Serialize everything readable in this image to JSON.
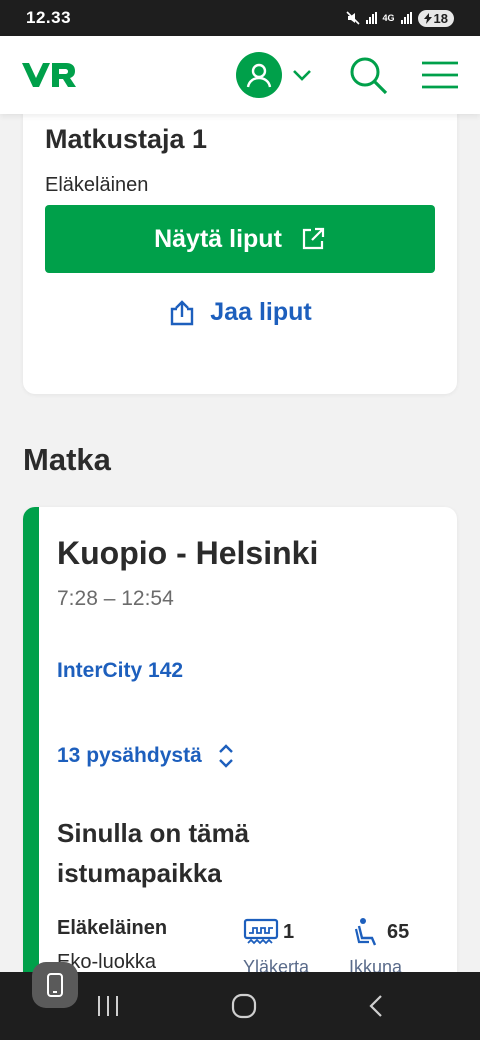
{
  "status_bar": {
    "time": "12.33",
    "network": "4G",
    "battery": "18"
  },
  "header": {
    "logo_text": "VR",
    "brand_color": "#00a04a",
    "icons": [
      "user-icon",
      "chevron-down-icon",
      "search-icon",
      "menu-icon"
    ]
  },
  "passenger_card": {
    "title": "Matkustaja 1",
    "type": "Eläkeläinen",
    "show_tickets_label": "Näytä liput",
    "share_label": "Jaa liput"
  },
  "trip_section": {
    "title": "Matka",
    "route": "Kuopio - Helsinki",
    "times": "7:28 – 12:54",
    "train": "InterCity 142",
    "stops_label": "13 pysähdystä",
    "seat_heading": "Sinulla on tämä istumapaikka",
    "seat": {
      "passenger": "Eläkeläinen",
      "class": "Eko-luokka",
      "coach_number": "1",
      "coach_label": "Yläkerta",
      "seat_number": "65",
      "seat_label": "Ikkuna"
    }
  },
  "colors": {
    "accent_green": "#00a04a",
    "link_blue": "#1d5fbd"
  }
}
